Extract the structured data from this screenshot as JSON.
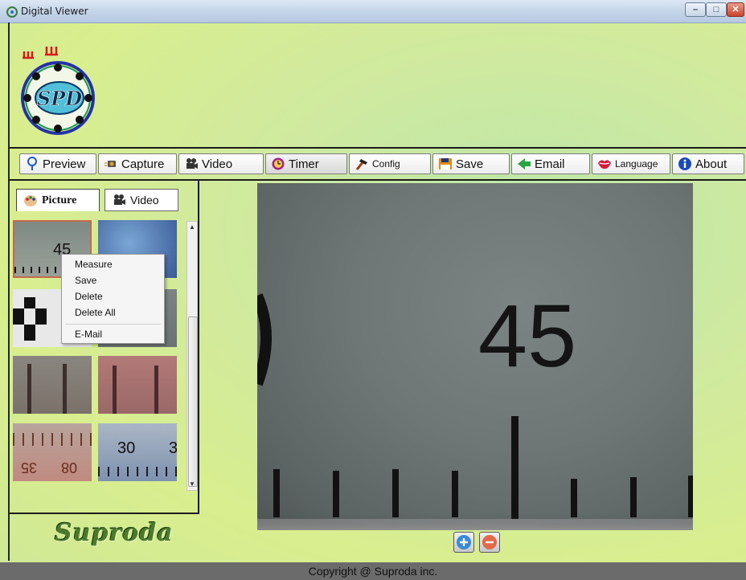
{
  "window": {
    "title": "Digital Viewer",
    "minimize_glyph": "–",
    "maximize_glyph": "□",
    "close_glyph": "✕"
  },
  "logo": {
    "text": "SPD"
  },
  "toolbar": {
    "items": [
      {
        "label": "Preview",
        "icon": "pin-icon"
      },
      {
        "label": "Capture",
        "icon": "camera-icon"
      },
      {
        "label": "Video",
        "icon": "video-camera-icon"
      },
      {
        "label": "Timer",
        "icon": "timer-icon"
      },
      {
        "label": "Config",
        "icon": "hammer-icon"
      },
      {
        "label": "Save",
        "icon": "floppy-icon"
      },
      {
        "label": "Email",
        "icon": "email-icon"
      },
      {
        "label": "Language",
        "icon": "lips-icon"
      },
      {
        "label": "About",
        "icon": "info-icon"
      }
    ]
  },
  "gallery": {
    "tabs": [
      {
        "label": "Picture",
        "icon": "palette-icon"
      },
      {
        "label": "Video",
        "icon": "video-camera-icon"
      }
    ],
    "thumb_labels": {
      "t1": "45",
      "t7": "30",
      "t7b": "3",
      "t6a": "35",
      "t6b": "08"
    }
  },
  "context_menu": {
    "items": [
      "Measure",
      "Save",
      "Delete",
      "Delete All",
      "E-Mail"
    ]
  },
  "viewer": {
    "reading": "45"
  },
  "brand": {
    "name": "Suproda"
  },
  "status": {
    "text": "Copyright @ Suproda inc."
  },
  "colors": {
    "accent": "#2a6fd6",
    "background": "#d4ec98",
    "status_bar": "#6b6b6b"
  }
}
